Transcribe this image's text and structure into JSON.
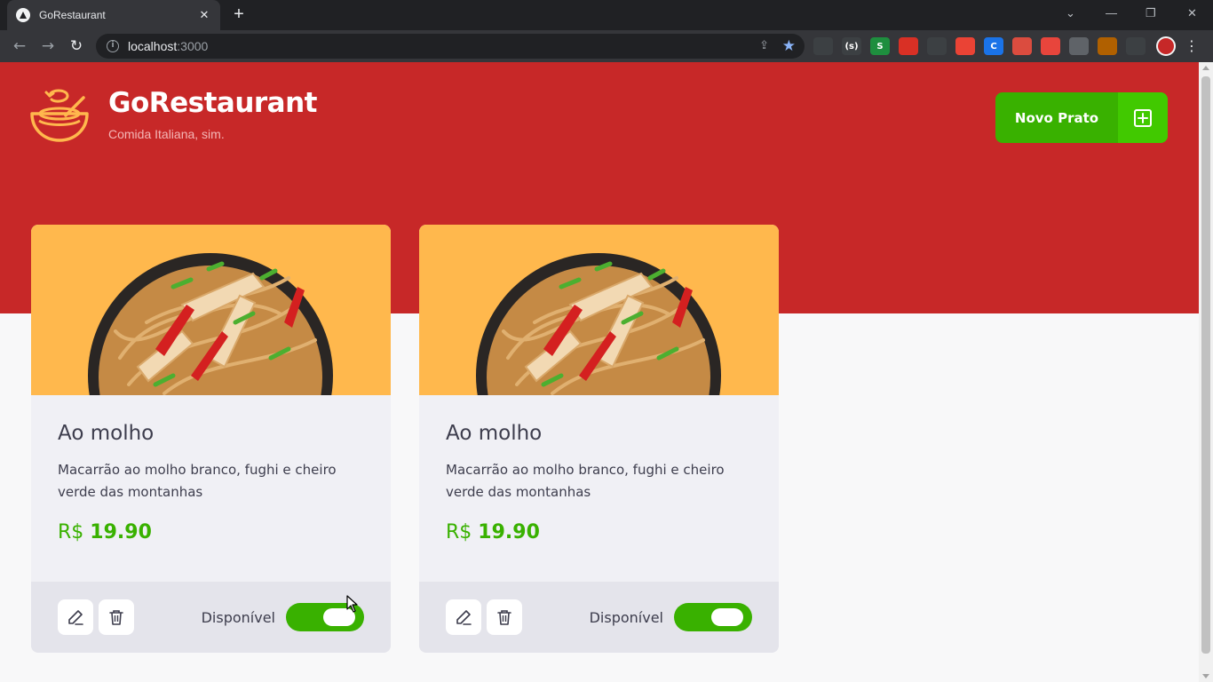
{
  "browser": {
    "tab_title": "GoRestaurant",
    "tab_close": "✕",
    "new_tab": "+",
    "url_host": "localhost",
    "url_port": ":3000",
    "window_controls": [
      "—",
      "❐",
      "✕"
    ],
    "extensions": [
      {
        "name": "ext-circle-icon",
        "label": "",
        "color": "#3c4043"
      },
      {
        "name": "ext-bracket-icon",
        "label": "(s)",
        "color": "#3c4043"
      },
      {
        "name": "ext-s-icon",
        "label": "S",
        "color": "#1e8e3e"
      },
      {
        "name": "ext-red-icon",
        "label": "",
        "color": "#d93025"
      },
      {
        "name": "ext-pen-icon",
        "label": "",
        "color": "#3c4043"
      },
      {
        "name": "ext-ball-icon",
        "label": "",
        "color": "#ea4335"
      },
      {
        "name": "ext-c-icon",
        "label": "C",
        "color": "#1a73e8"
      },
      {
        "name": "ext-todoist-icon",
        "label": "",
        "color": "#db4c3f"
      },
      {
        "name": "ext-video-icon",
        "label": "",
        "color": "#e8453c"
      },
      {
        "name": "ext-target-icon",
        "label": "",
        "color": "#5f6368"
      },
      {
        "name": "ext-face-icon",
        "label": "",
        "color": "#b06000"
      },
      {
        "name": "ext-puzzle-icon",
        "label": "",
        "color": "#3c4043"
      }
    ]
  },
  "header": {
    "title": "GoRestaurant",
    "subtitle": "Comida Italiana, sim.",
    "new_dish_label": "Novo Prato"
  },
  "foods": [
    {
      "name": "Ao molho",
      "description": "Macarrão ao molho branco, fughi e cheiro verde das montanhas",
      "currency": "R$",
      "price": "19.90",
      "available_label": "Disponível",
      "available": true
    },
    {
      "name": "Ao molho",
      "description": "Macarrão ao molho branco, fughi e cheiro verde das montanhas",
      "currency": "R$",
      "price": "19.90",
      "available_label": "Disponível",
      "available": true
    }
  ],
  "colors": {
    "brand_red": "#c72828",
    "accent_green": "#39b100",
    "card_image_bg": "#ffb84d"
  }
}
